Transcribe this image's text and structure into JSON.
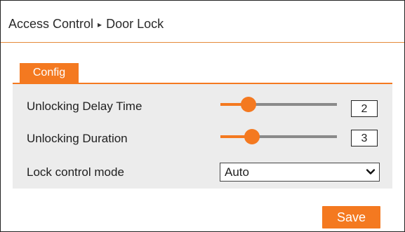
{
  "breadcrumb": {
    "section": "Access Control",
    "separator": "▸",
    "page": "Door Lock"
  },
  "tabs": [
    {
      "label": "Config",
      "active": true
    }
  ],
  "form": {
    "unlocking_delay_time": {
      "label": "Unlocking Delay Time",
      "value": "2",
      "slider_fraction": 0.24
    },
    "unlocking_duration": {
      "label": "Unlocking Duration",
      "value": "3",
      "slider_fraction": 0.27
    },
    "lock_control_mode": {
      "label": "Lock control mode",
      "selected": "Auto"
    }
  },
  "actions": {
    "save_label": "Save"
  },
  "colors": {
    "accent": "#f47920",
    "panel": "#ececec",
    "track": "#8a8a8a"
  }
}
